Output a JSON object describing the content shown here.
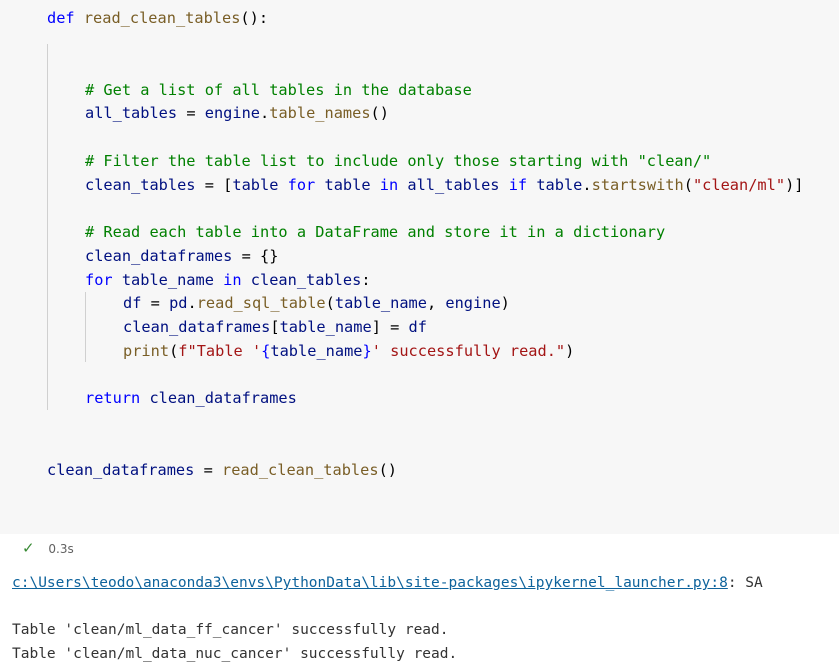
{
  "code_lines": [
    {
      "segments": [
        {
          "t": "def ",
          "c": "kw"
        },
        {
          "t": "read_clean_tables",
          "c": "fn"
        },
        {
          "t": "():",
          "c": ""
        }
      ]
    },
    {
      "segments": []
    },
    {
      "segments": []
    },
    {
      "segments": [
        {
          "t": "# Get a list of all tables in the database",
          "c": "cm"
        }
      ]
    },
    {
      "segments": [
        {
          "t": "all_tables",
          "c": "vr"
        },
        {
          "t": " = ",
          "c": ""
        },
        {
          "t": "engine",
          "c": "vr"
        },
        {
          "t": ".",
          "c": ""
        },
        {
          "t": "table_names",
          "c": "fn"
        },
        {
          "t": "()",
          "c": ""
        }
      ]
    },
    {
      "segments": []
    },
    {
      "segments": [
        {
          "t": "# Filter the table list to include only those starting with \"clean/\"",
          "c": "cm"
        }
      ]
    },
    {
      "segments": [
        {
          "t": "clean_tables",
          "c": "vr"
        },
        {
          "t": " = [",
          "c": ""
        },
        {
          "t": "table",
          "c": "vr"
        },
        {
          "t": " for ",
          "c": "kw"
        },
        {
          "t": "table",
          "c": "vr"
        },
        {
          "t": " in ",
          "c": "kw"
        },
        {
          "t": "all_tables",
          "c": "vr"
        },
        {
          "t": " if ",
          "c": "kw"
        },
        {
          "t": "table",
          "c": "vr"
        },
        {
          "t": ".",
          "c": ""
        },
        {
          "t": "startswith",
          "c": "fn"
        },
        {
          "t": "(",
          "c": ""
        },
        {
          "t": "\"clean/ml\"",
          "c": "st"
        },
        {
          "t": ")]",
          "c": ""
        }
      ]
    },
    {
      "segments": []
    },
    {
      "segments": [
        {
          "t": "# Read each table into a DataFrame and store it in a dictionary",
          "c": "cm"
        }
      ]
    },
    {
      "segments": [
        {
          "t": "clean_dataframes",
          "c": "vr"
        },
        {
          "t": " = {}",
          "c": ""
        }
      ]
    },
    {
      "segments": [
        {
          "t": "for ",
          "c": "kw"
        },
        {
          "t": "table_name",
          "c": "vr"
        },
        {
          "t": " in ",
          "c": "kw"
        },
        {
          "t": "clean_tables",
          "c": "vr"
        },
        {
          "t": ":",
          "c": ""
        }
      ]
    },
    {
      "segments": [
        {
          "t": "df",
          "c": "vr"
        },
        {
          "t": " = ",
          "c": ""
        },
        {
          "t": "pd",
          "c": "vr"
        },
        {
          "t": ".",
          "c": ""
        },
        {
          "t": "read_sql_table",
          "c": "fn"
        },
        {
          "t": "(",
          "c": ""
        },
        {
          "t": "table_name",
          "c": "vr"
        },
        {
          "t": ", ",
          "c": ""
        },
        {
          "t": "engine",
          "c": "vr"
        },
        {
          "t": ")",
          "c": ""
        }
      ]
    },
    {
      "segments": [
        {
          "t": "clean_dataframes",
          "c": "vr"
        },
        {
          "t": "[",
          "c": ""
        },
        {
          "t": "table_name",
          "c": "vr"
        },
        {
          "t": "] = ",
          "c": ""
        },
        {
          "t": "df",
          "c": "vr"
        }
      ]
    },
    {
      "segments": [
        {
          "t": "print",
          "c": "fn"
        },
        {
          "t": "(",
          "c": ""
        },
        {
          "t": "f\"Table '",
          "c": "st"
        },
        {
          "t": "{",
          "c": "kw"
        },
        {
          "t": "table_name",
          "c": "vr"
        },
        {
          "t": "}",
          "c": "kw"
        },
        {
          "t": "' successfully read.\"",
          "c": "st"
        },
        {
          "t": ")",
          "c": ""
        }
      ]
    },
    {
      "segments": []
    },
    {
      "segments": [
        {
          "t": "return ",
          "c": "kw"
        },
        {
          "t": "clean_dataframes",
          "c": "vr"
        }
      ]
    },
    {
      "segments": []
    },
    {
      "segments": []
    },
    {
      "segments": [
        {
          "t": "clean_dataframes",
          "c": "vr"
        },
        {
          "t": " = ",
          "c": ""
        },
        {
          "t": "read_clean_tables",
          "c": "fn"
        },
        {
          "t": "()",
          "c": ""
        }
      ]
    }
  ],
  "status": {
    "check_icon": "check-icon",
    "duration": "0.3s"
  },
  "output": {
    "warning_path": "c:\\Users\\teodo\\anaconda3\\envs\\PythonData\\lib\\site-packages\\ipykernel_launcher.py:8",
    "warning_suffix": ": SA",
    "lines": [
      "Table 'clean/ml_data_ff_cancer' successfully read.",
      "Table 'clean/ml_data_nuc_cancer' successfully read."
    ]
  }
}
